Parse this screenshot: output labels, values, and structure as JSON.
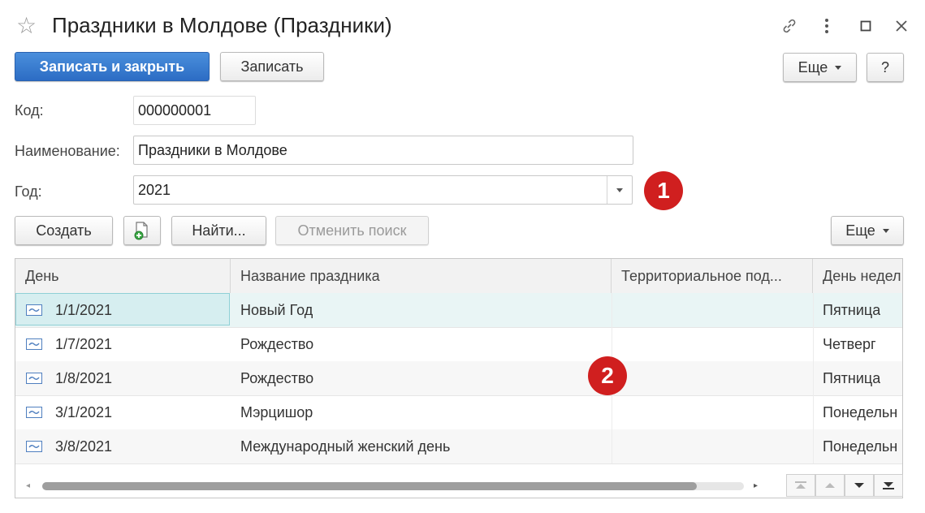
{
  "window": {
    "title": "Праздники в Молдове (Праздники)"
  },
  "toolbar": {
    "save_close_label": "Записать и закрыть",
    "save_label": "Записать",
    "more_label": "Еще",
    "help_label": "?"
  },
  "form": {
    "code_label": "Код:",
    "code_value": "000000001",
    "name_label": "Наименование:",
    "name_value": "Праздники в Молдове",
    "year_label": "Год:",
    "year_value": "2021"
  },
  "badges": {
    "first": "1",
    "second": "2"
  },
  "table_toolbar": {
    "create_label": "Создать",
    "find_label": "Найти...",
    "cancel_search_label": "Отменить поиск",
    "more_label": "Еще"
  },
  "table": {
    "columns": [
      "День",
      "Название праздника",
      "Территориальное под...",
      "День недел"
    ],
    "rows": [
      {
        "day": "1/1/2021",
        "name": "Новый Год",
        "territory": "",
        "weekday": "Пятница"
      },
      {
        "day": "1/7/2021",
        "name": "Рождество",
        "territory": "",
        "weekday": "Четверг"
      },
      {
        "day": "1/8/2021",
        "name": "Рождество",
        "territory": "",
        "weekday": "Пятница"
      },
      {
        "day": "3/1/2021",
        "name": "Мэрцишор",
        "territory": "",
        "weekday": "Понедельн"
      },
      {
        "day": "3/8/2021",
        "name": "Международный женский день",
        "territory": "",
        "weekday": "Понедельн"
      }
    ]
  },
  "colors": {
    "primary": "#2c6cc4",
    "badge": "#d01f1f",
    "selected_row": "#e9f5f5"
  }
}
